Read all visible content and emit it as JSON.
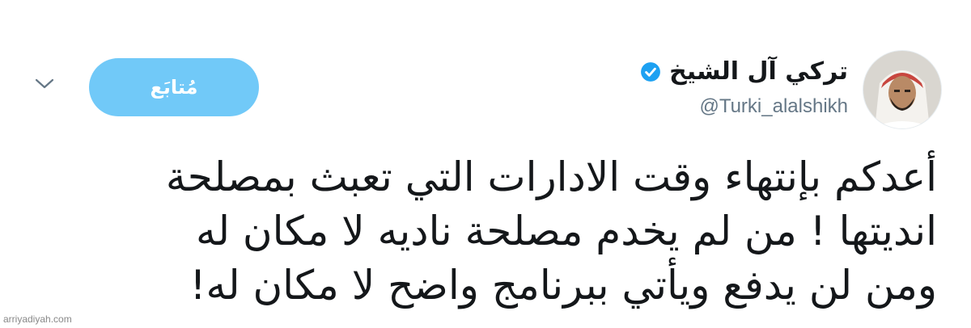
{
  "tweet": {
    "author": {
      "display_name": "تركي آل الشيخ",
      "handle": "@Turki_alalshikh",
      "verified": true
    },
    "follow_button": {
      "label": "مُتابَع"
    },
    "menu_icon": "chevron-down-icon",
    "text_lines": [
      "أعدكم بإنتهاء وقت الادارات التي تعبث بمصلحة",
      "انديتها ! من لم يخدم مصلحة ناديه لا مكان له",
      "ومن لن يدفع ويأتي ببرنامج واضح لا مكان له!"
    ]
  },
  "watermark": {
    "text": "arriyadiyah.com"
  },
  "colors": {
    "follow_button_bg": "#71c9f8",
    "verified_badge": "#1da1f2",
    "handle_text": "#657786",
    "body_text": "#14171a"
  }
}
